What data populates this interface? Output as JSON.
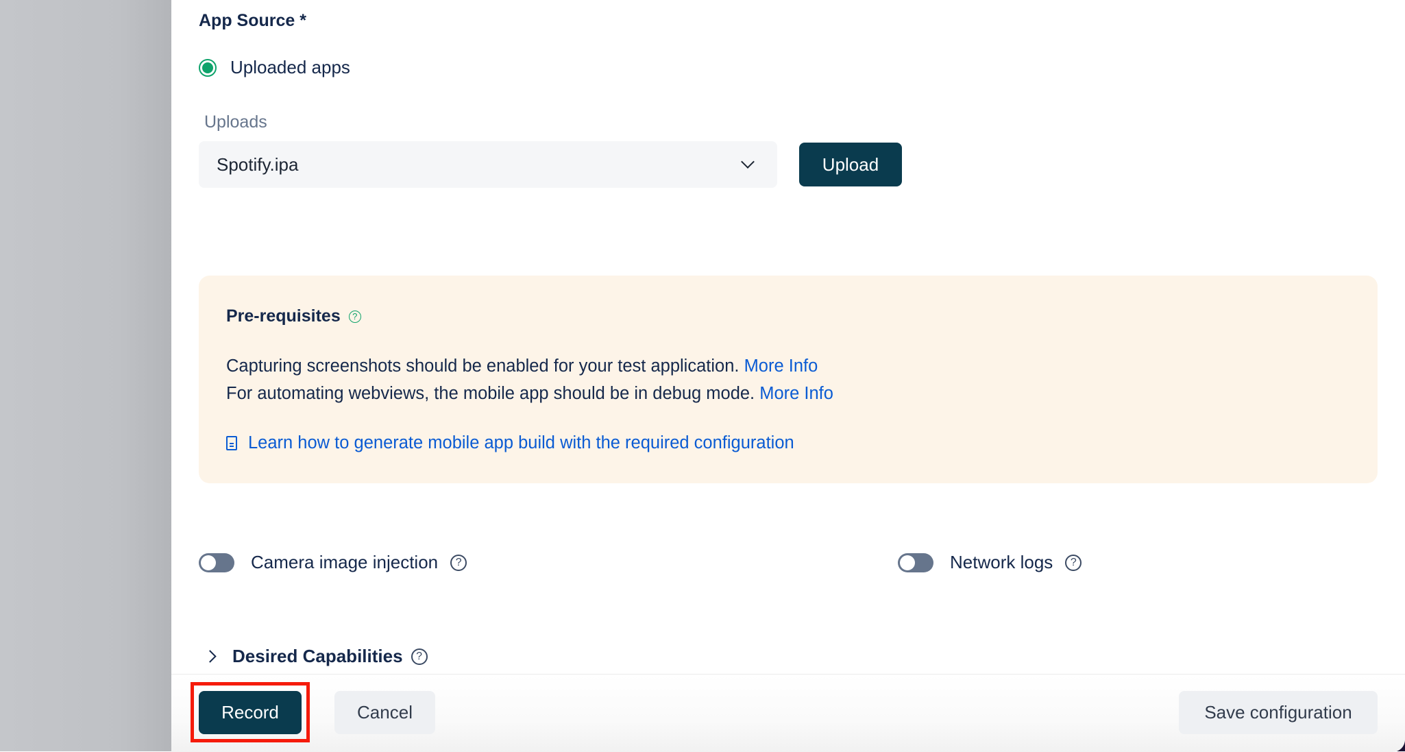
{
  "app_source": {
    "title": "App Source *",
    "radio_option": "Uploaded apps",
    "radio_selected": true
  },
  "uploads": {
    "label": "Uploads",
    "selected_value": "Spotify.ipa",
    "upload_button": "Upload"
  },
  "prerequisites": {
    "title": "Pre-requisites",
    "help_glyph": "?",
    "line1_text": "Capturing screenshots should be enabled for your test application.",
    "line1_link": "More Info",
    "line2_text": "For automating webviews, the mobile app should be in debug mode.",
    "line2_link": "More Info",
    "learn_link": "Learn how to generate mobile app build with the required configuration",
    "accent_color": "#0fa36b",
    "link_color": "#0a5bd3"
  },
  "toggles": [
    {
      "label": "Camera image injection",
      "enabled": false,
      "help_glyph": "?"
    },
    {
      "label": "Network logs",
      "enabled": false,
      "help_glyph": "?"
    }
  ],
  "desired_capabilities": {
    "label": "Desired Capabilities",
    "expanded": false,
    "help_glyph": "?"
  },
  "footer": {
    "record": "Record",
    "cancel": "Cancel",
    "save": "Save configuration",
    "primary_color": "#0a3b4e",
    "highlight_color": "#f51b0b"
  }
}
